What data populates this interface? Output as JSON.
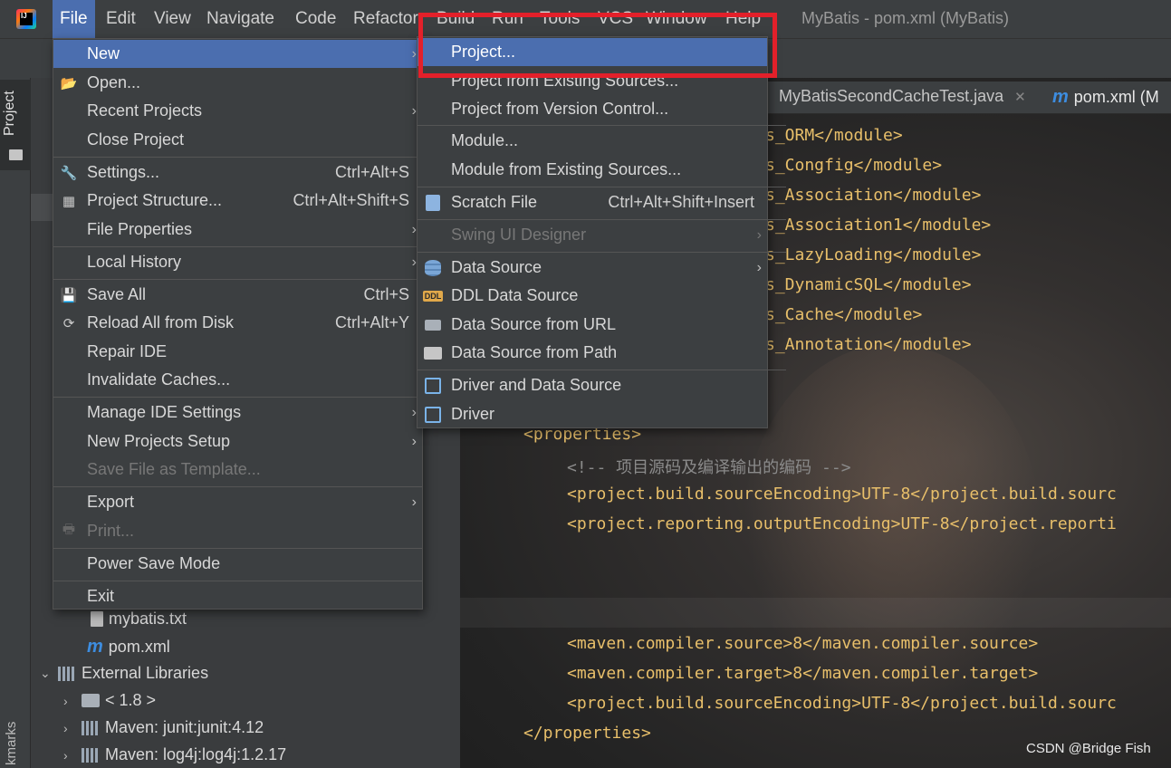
{
  "app": {
    "logo_text": "IJ",
    "window_title": "MyBatis - pom.xml (MyBatis)"
  },
  "menubar": {
    "items": [
      "File",
      "Edit",
      "View",
      "Navigate",
      "Code",
      "Refactor",
      "Build",
      "Run",
      "Tools",
      "VCS",
      "Window",
      "Help"
    ]
  },
  "sidebar": {
    "project_label": "Project",
    "bookmarks_label": "kmarks"
  },
  "project_tree": {
    "rows": [
      {
        "label": "mybatis.txt",
        "icon": "text-file-icon"
      },
      {
        "label": "pom.xml",
        "icon": "maven-icon"
      },
      {
        "label": "External Libraries",
        "icon": "library-icon"
      },
      {
        "label": "< 1.8 >",
        "icon": "folder-icon"
      },
      {
        "label": "Maven: junit:junit:4.12",
        "icon": "library-icon"
      },
      {
        "label": "Maven: log4j:log4j:1.2.17",
        "icon": "library-icon"
      }
    ]
  },
  "editor": {
    "tabs": [
      {
        "label": "MyBatisSecondCacheTest.java",
        "icon": "java-class-icon"
      },
      {
        "label": "pom.xml (M",
        "icon": "maven-icon"
      }
    ],
    "lines": [
      "s_ORM</module>",
      "s_Congfig</module>",
      "s_Association</module>",
      "s_Association1</module>",
      "s_LazyLoading</module>",
      "s_DynamicSQL</module>",
      "s_Cache</module>",
      "s_Annotation</module>",
      "<properties>",
      "<!-- 项目源码及编译输出的编码 -->",
      "<project.build.sourceEncoding>UTF-8</project.build.sourc",
      "<project.reporting.outputEncoding>UTF-8</project.reporti",
      "<maven.compiler.source>8</maven.compiler.source>",
      "<maven.compiler.target>8</maven.compiler.target>",
      "<project.build.sourceEncoding>UTF-8</project.build.sourc",
      "</properties>"
    ]
  },
  "file_menu": {
    "items": [
      {
        "label": "New",
        "arrow": true,
        "highlighted": true
      },
      {
        "label": "Open...",
        "icon": "folder-open-icon"
      },
      {
        "label": "Recent Projects",
        "arrow": true
      },
      {
        "label": "Close Project"
      },
      {
        "label": "Settings...",
        "shortcut": "Ctrl+Alt+S",
        "icon": "wrench-icon"
      },
      {
        "label": "Project Structure...",
        "shortcut": "Ctrl+Alt+Shift+S",
        "icon": "project-structure-icon"
      },
      {
        "label": "File Properties",
        "arrow": true
      },
      {
        "label": "Local History",
        "arrow": true
      },
      {
        "label": "Save All",
        "shortcut": "Ctrl+S",
        "icon": "save-icon"
      },
      {
        "label": "Reload All from Disk",
        "shortcut": "Ctrl+Alt+Y",
        "icon": "reload-icon"
      },
      {
        "label": "Repair IDE"
      },
      {
        "label": "Invalidate Caches..."
      },
      {
        "label": "Manage IDE Settings",
        "arrow": true
      },
      {
        "label": "New Projects Setup",
        "arrow": true
      },
      {
        "label": "Save File as Template...",
        "disabled": true
      },
      {
        "label": "Export",
        "arrow": true
      },
      {
        "label": "Print...",
        "disabled": true,
        "icon": "print-icon"
      },
      {
        "label": "Power Save Mode"
      },
      {
        "label": "Exit"
      }
    ]
  },
  "new_submenu": {
    "items": [
      {
        "label": "Project...",
        "highlighted": true
      },
      {
        "label": "Project from Existing Sources..."
      },
      {
        "label": "Project from Version Control..."
      },
      {
        "label": "Module..."
      },
      {
        "label": "Module from Existing Sources..."
      },
      {
        "label": "Scratch File",
        "shortcut": "Ctrl+Alt+Shift+Insert",
        "icon": "scratch-file-icon"
      },
      {
        "label": "Swing UI Designer",
        "arrow": true,
        "disabled": true
      },
      {
        "label": "Data Source",
        "arrow": true,
        "icon": "database-icon"
      },
      {
        "label": "DDL Data Source",
        "icon": "ddl-icon"
      },
      {
        "label": "Data Source from URL",
        "icon": "plug-icon"
      },
      {
        "label": "Data Source from Path",
        "icon": "folder-icon"
      },
      {
        "label": "Driver and Data Source",
        "icon": "driver-icon"
      },
      {
        "label": "Driver",
        "icon": "driver-icon"
      }
    ]
  },
  "colors": {
    "highlight": "#4b6eaf",
    "annotation_box": "#e3202a",
    "xml_tag": "#e8bf6a"
  },
  "watermark": "CSDN @Bridge Fish"
}
